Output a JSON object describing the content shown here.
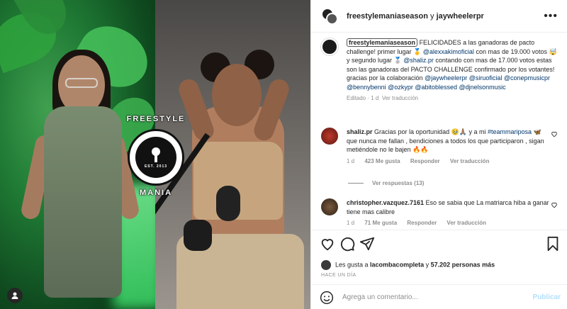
{
  "post": {
    "header": {
      "account1": "freestylemaniaseason",
      "connector": "y",
      "account2": "jaywheelerpr",
      "more_icon": "more-horizontal-icon"
    },
    "media": {
      "logo_top": "FREESTYLE",
      "logo_bottom": "MANIA",
      "logo_small": "EST. 2013",
      "tag_icon": "user-tag-icon"
    },
    "caption": {
      "username": "freestylemaniaseason",
      "text1": " FELICIDADES a las ganadoras de pacto challenge! primer lugar 🥇 ",
      "mention1": "@alexxakimoficial",
      "text2": " con mas de 19.000 votos 🤯 y segundo lugar 🥈 ",
      "mention2": "@shaliz.pr",
      "text3": " contando con mas de 17.000 votos estas son las ganadoras del PACTO CHALLENGE confirmado por los votantes! gracias por la colaboración ",
      "mentions": "@jaywheelerpr @siruoficial @conepmusicpr @bennybenni @ozkypr @abitoblessed @djnelsonmusic",
      "edited": "Editado · 1 d",
      "see_translation": "Ver traducción"
    },
    "comments": [
      {
        "username": "shaliz.pr",
        "text_a": " Gracias por la oportunidad 🥹🙏🏽 y a mi ",
        "hashtag": "#teammariposa",
        "text_b": " 🦋 que nunca me fallan , bendiciones a todos los que participaron , sigan metiéndole no le bajen 🔥🔥",
        "time": "1 d",
        "likes": "423 Me gusta",
        "reply": "Responder",
        "translate": "Ver traducción",
        "view_replies": "Ver respuestas (13)"
      },
      {
        "username": "christopher.vazquez.7161",
        "text": " Eso se sabia que La matriarca hiba a ganar tiene mas calibre",
        "time": "1 d",
        "likes": "71 Me gusta",
        "reply": "Responder",
        "translate": "Ver traducción"
      }
    ],
    "actions": {
      "likes_prefix": "Les gusta a ",
      "liker": "lacombacompleta",
      "likes_mid": " y ",
      "likes_count": "57.202 personas más",
      "ago": "HACE UN DÍA",
      "comment_placeholder": "Agrega un comentario...",
      "publish": "Publicar"
    }
  },
  "colors": {
    "mention": "#00376b",
    "muted": "#8e8e8e",
    "publish_disabled": "#b2dffc"
  }
}
